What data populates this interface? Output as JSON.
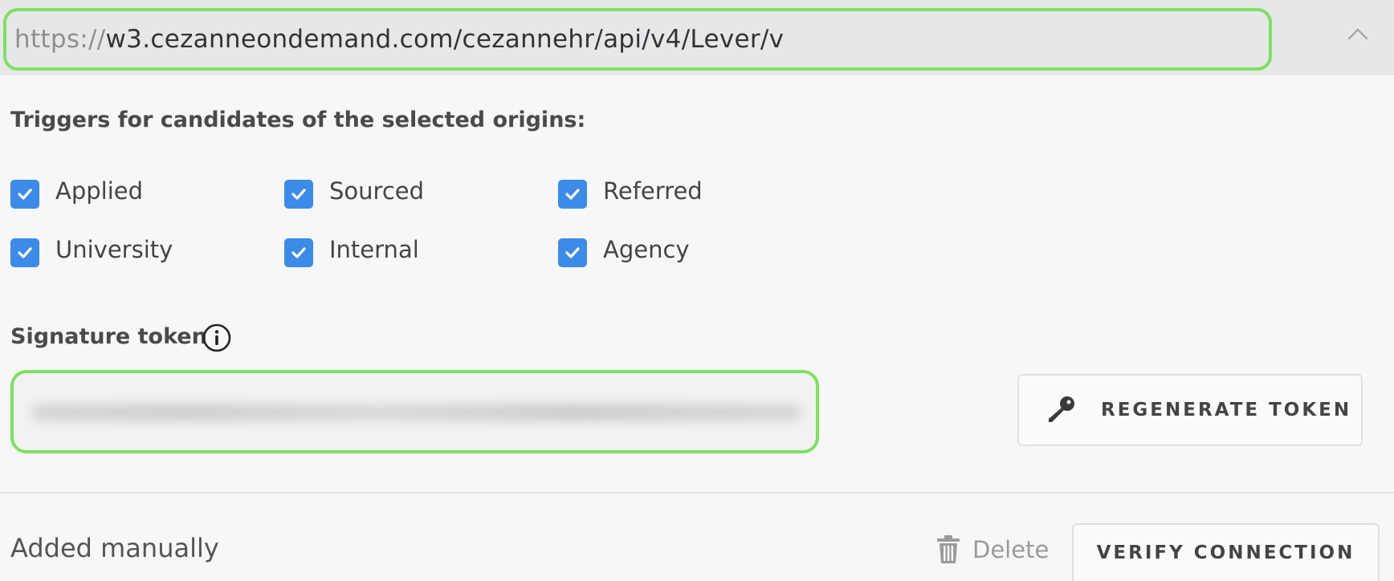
{
  "webhook": {
    "url_scheme": "https://",
    "url_rest": "w3.cezanneondemand.com/cezannehr/api/v4/Lever/v",
    "collapse_icon": "chevron-up-icon"
  },
  "triggers": {
    "title": "Triggers for candidates of the selected origins:",
    "options": [
      {
        "label": "Applied",
        "checked": true
      },
      {
        "label": "Sourced",
        "checked": true
      },
      {
        "label": "Referred",
        "checked": true
      },
      {
        "label": "University",
        "checked": true
      },
      {
        "label": "Internal",
        "checked": true
      },
      {
        "label": "Agency",
        "checked": true
      }
    ]
  },
  "signature": {
    "title": "Signature token",
    "info_icon": "info-icon",
    "regenerate_label": "REGENERATE TOKEN",
    "regenerate_icon": "key-icon"
  },
  "footer": {
    "added_text": "Added manually",
    "delete_label": "Delete",
    "delete_icon": "trash-icon",
    "verify_label": "VERIFY CONNECTION"
  },
  "colors": {
    "checkbox": "#3d8be8",
    "highlight": "#7ee060"
  }
}
